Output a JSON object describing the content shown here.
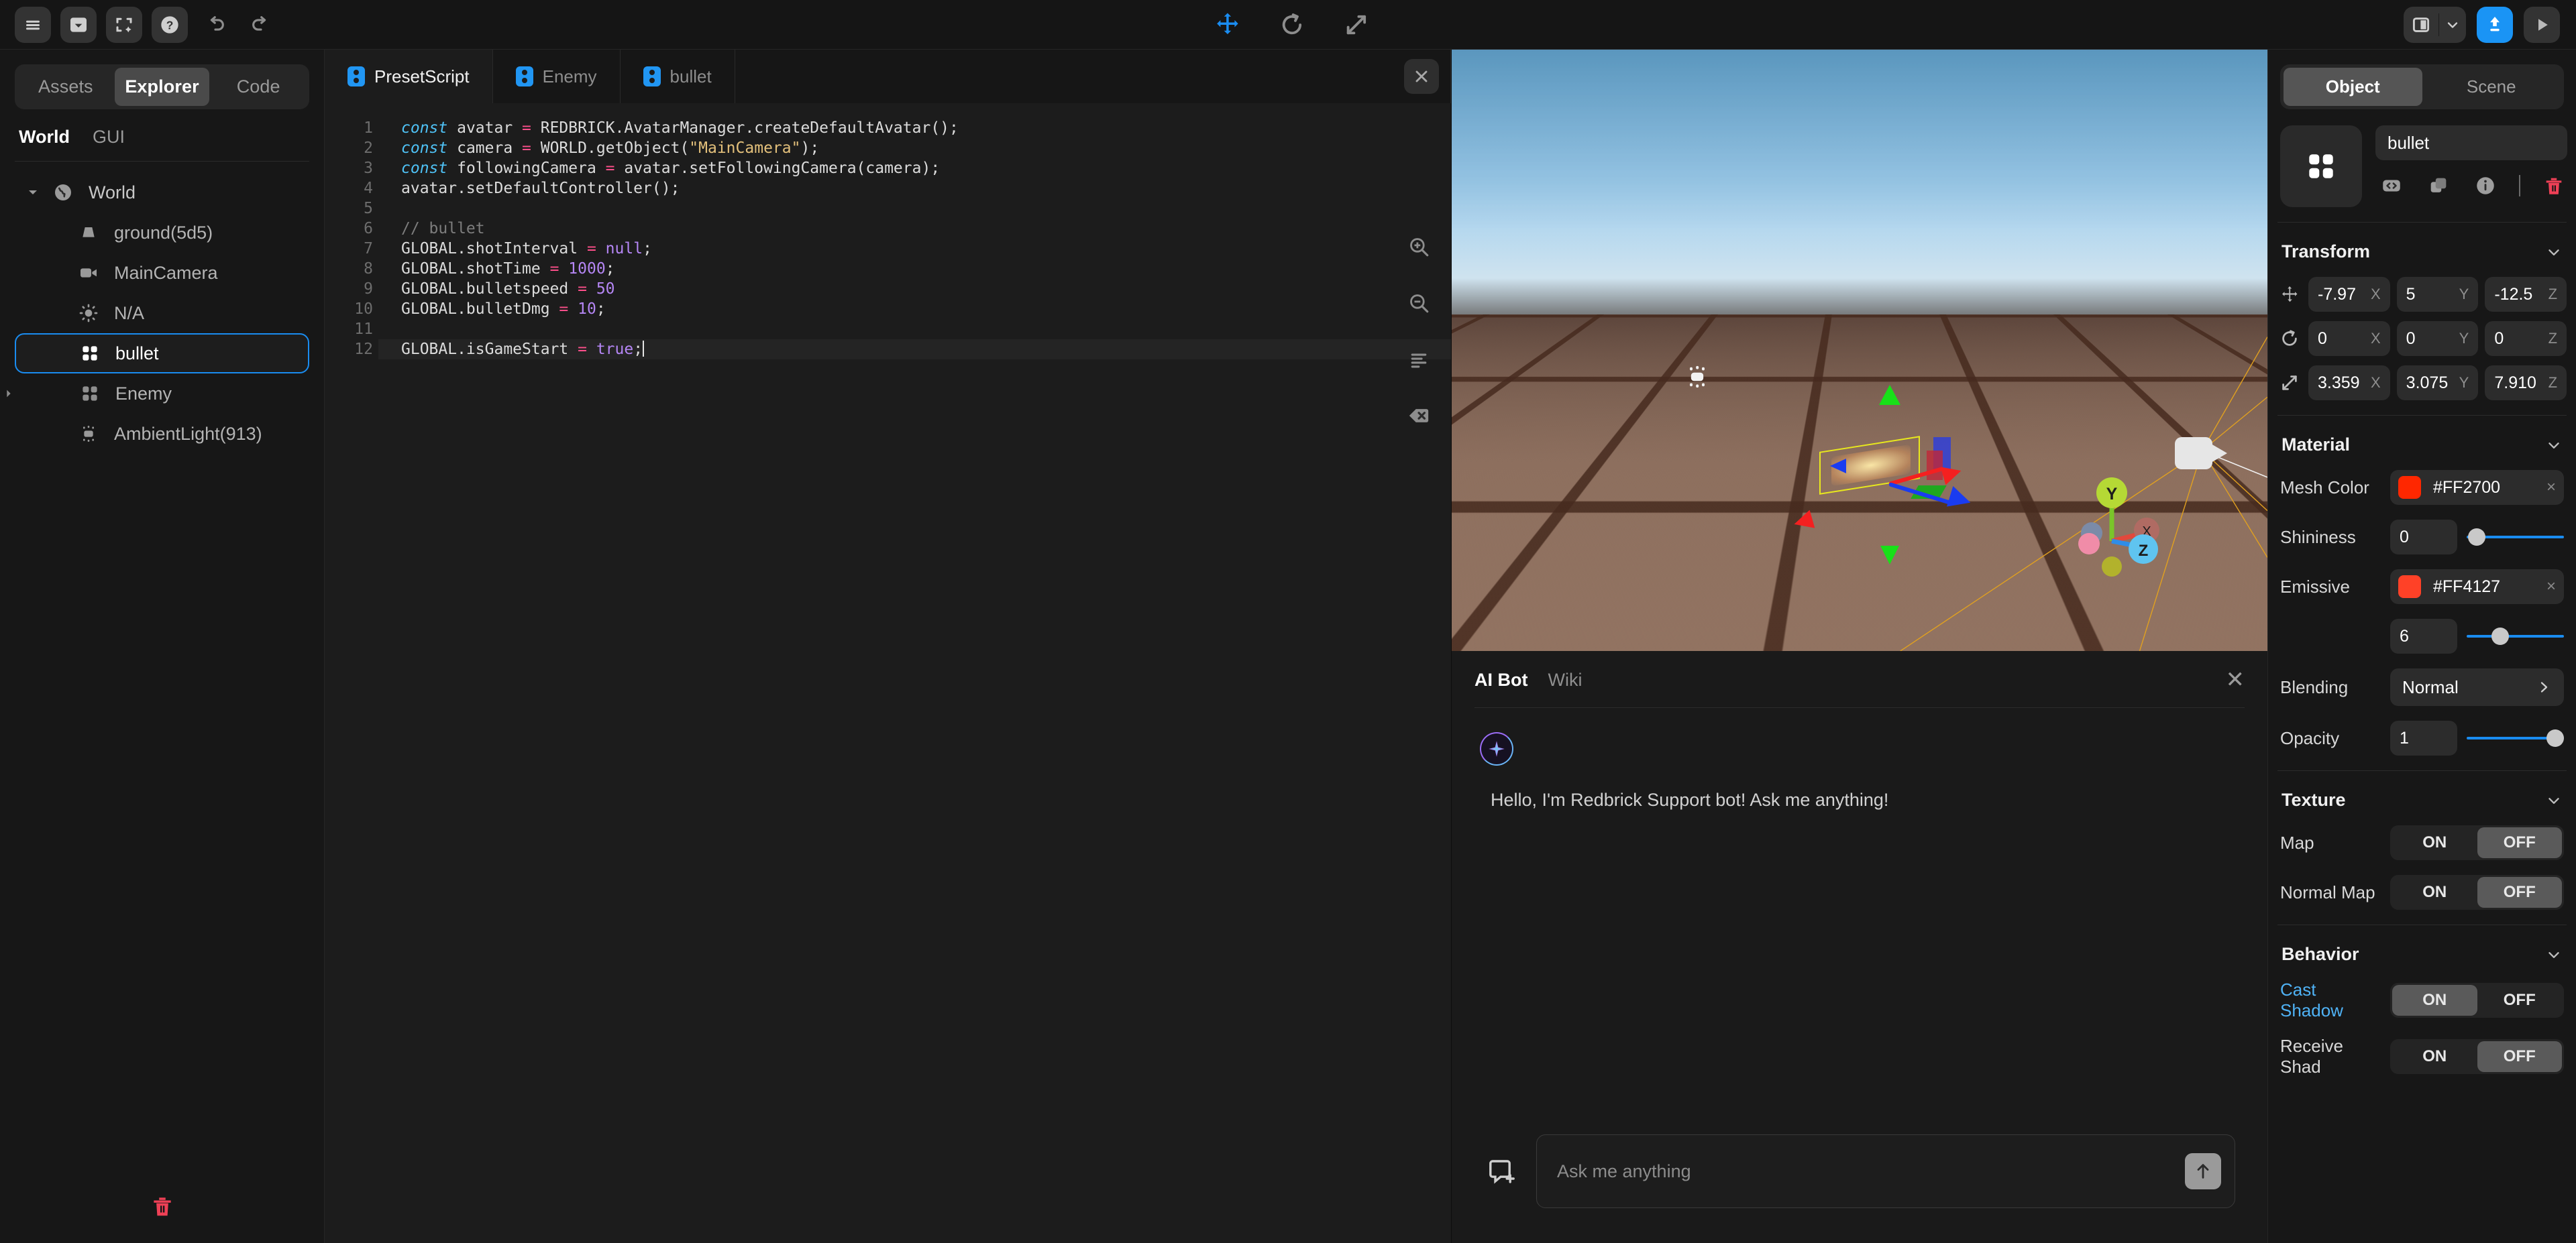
{
  "topbar": {
    "left_icons": [
      "menu-icon",
      "panel-icon",
      "fullscreen-icon",
      "help-icon",
      "undo-icon",
      "redo-icon"
    ],
    "center_tools": [
      {
        "name": "move-tool",
        "active": true
      },
      {
        "name": "rotate-tool",
        "active": false
      },
      {
        "name": "scale-tool",
        "active": false
      }
    ],
    "right": {
      "layout_icon": "panel-layout-icon",
      "layout_chevron": "chevron-down-icon",
      "publish_icon": "publish-upload-icon",
      "play_icon": "play-icon",
      "accent": "#1a94f5"
    }
  },
  "sidebar": {
    "tabs": [
      {
        "label": "Assets",
        "active": false
      },
      {
        "label": "Explorer",
        "active": true
      },
      {
        "label": "Code",
        "active": false
      }
    ],
    "subtabs": [
      {
        "label": "World",
        "active": true
      },
      {
        "label": "GUI",
        "active": false
      }
    ],
    "tree": [
      {
        "label": "World",
        "icon": "globe-icon",
        "indent": 1,
        "caret": "expanded",
        "selected": false
      },
      {
        "label": "ground(5d5)",
        "icon": "mesh-icon",
        "indent": 2,
        "caret": "none",
        "selected": false
      },
      {
        "label": "MainCamera",
        "icon": "camera-icon",
        "indent": 2,
        "caret": "none",
        "selected": false
      },
      {
        "label": "N/A",
        "icon": "light-icon",
        "indent": 2,
        "caret": "none",
        "selected": false
      },
      {
        "label": "bullet",
        "icon": "group-icon",
        "indent": 2,
        "caret": "none",
        "selected": true
      },
      {
        "label": "Enemy",
        "icon": "group-icon",
        "indent": 3,
        "caret": "collapsed",
        "selected": false
      },
      {
        "label": "AmbientLight(913)",
        "icon": "ambient-light-icon",
        "indent": 2,
        "caret": "none",
        "selected": false
      }
    ],
    "delete_icon": "trash-icon",
    "delete_color": "#ef4056"
  },
  "code_editor": {
    "tabs": [
      {
        "label": "PresetScript",
        "active": true
      },
      {
        "label": "Enemy",
        "active": false
      },
      {
        "label": "bullet",
        "active": false
      }
    ],
    "close_label": "✕",
    "line_numbers": [
      "1",
      "2",
      "3",
      "4",
      "5",
      "6",
      "7",
      "8",
      "9",
      "10",
      "11",
      "12"
    ],
    "lines": [
      "const avatar = REDBRICK.AvatarManager.createDefaultAvatar();",
      "const camera = WORLD.getObject(\"MainCamera\");",
      "const followingCamera = avatar.setFollowingCamera(camera);",
      "avatar.setDefaultController();",
      "",
      "// bullet",
      "GLOBAL.shotInterval = null;",
      "GLOBAL.shotTime = 1000;",
      "GLOBAL.bulletspeed = 50",
      "GLOBAL.bulletDmg = 10;",
      "",
      "GLOBAL.isGameStart = true;"
    ],
    "current_line": 12,
    "tools": [
      "zoom-in-icon",
      "zoom-out-icon",
      "format-lines-icon",
      "clear-tag-icon"
    ]
  },
  "viewport": {
    "gizmo_axes": [
      {
        "label": "Y",
        "color": "#b5d935"
      },
      {
        "label": "X",
        "color": "#b06b63"
      },
      {
        "label": "Z",
        "color": "#5fc4f0"
      }
    ],
    "objects": [
      "selected-bullet-mesh",
      "main-camera-gizmo",
      "light-gizmo",
      "ground-plane"
    ]
  },
  "chat": {
    "tabs": [
      {
        "label": "AI Bot",
        "active": true
      },
      {
        "label": "Wiki",
        "active": false
      }
    ],
    "close_label": "✕",
    "avatar_icon": "sparkle-icon",
    "message": "Hello, I'm Redbrick Support bot! Ask me anything!",
    "input_value": "",
    "input_placeholder": "Ask me anything",
    "attach_icon": "attach-note-icon",
    "send_icon": "arrow-up-icon"
  },
  "inspector": {
    "tabs": [
      {
        "label": "Object",
        "active": true
      },
      {
        "label": "Scene",
        "active": false
      }
    ],
    "object_thumb_icon": "group-icon",
    "object_name": "bullet",
    "actions": [
      {
        "name": "code-icon"
      },
      {
        "name": "duplicate-icon"
      },
      {
        "name": "info-icon"
      },
      {
        "name": "trash-icon"
      }
    ],
    "delete_color": "#ef4056",
    "transform": {
      "title": "Transform",
      "chevron": "chevron-down-icon",
      "rows": [
        {
          "icon": "move-icon",
          "fields": [
            {
              "value": "-7.97",
              "axis": "X"
            },
            {
              "value": "5",
              "axis": "Y"
            },
            {
              "value": "-12.5",
              "axis": "Z"
            }
          ]
        },
        {
          "icon": "rotate-icon",
          "fields": [
            {
              "value": "0",
              "axis": "X"
            },
            {
              "value": "0",
              "axis": "Y"
            },
            {
              "value": "0",
              "axis": "Z"
            }
          ]
        },
        {
          "icon": "scale-icon",
          "fields": [
            {
              "value": "3.359",
              "axis": "X"
            },
            {
              "value": "3.075",
              "axis": "Y"
            },
            {
              "value": "7.910",
              "axis": "Z"
            }
          ]
        }
      ]
    },
    "material": {
      "title": "Material",
      "chevron": "chevron-down-icon",
      "mesh_color_label": "Mesh Color",
      "mesh_color_hex": "#FF2700",
      "shininess_label": "Shininess",
      "shininess_value": "0",
      "shininess_pct": 2,
      "emissive_label": "Emissive",
      "emissive_hex": "#FF4127",
      "emissive_value": "6",
      "emissive_pct": 31,
      "blending_label": "Blending",
      "blending_value": "Normal",
      "blending_chevron": "chevron-right-icon",
      "opacity_label": "Opacity",
      "opacity_value": "1",
      "opacity_pct": 100,
      "clear_label": "×",
      "slider_color": "#1a8cf0"
    },
    "texture": {
      "title": "Texture",
      "chevron": "chevron-down-icon",
      "rows": [
        {
          "label": "Map",
          "on_label": "ON",
          "off_label": "OFF",
          "state": "OFF"
        },
        {
          "label": "Normal Map",
          "on_label": "ON",
          "off_label": "OFF",
          "state": "OFF"
        }
      ]
    },
    "behavior": {
      "title": "Behavior",
      "chevron": "chevron-down-icon",
      "rows": [
        {
          "label": "Cast Shadow",
          "on_label": "ON",
          "off_label": "OFF",
          "state": "ON",
          "accent": true
        },
        {
          "label": "Receive Shad",
          "on_label": "ON",
          "off_label": "OFF",
          "state": "OFF",
          "accent": false
        }
      ]
    }
  }
}
